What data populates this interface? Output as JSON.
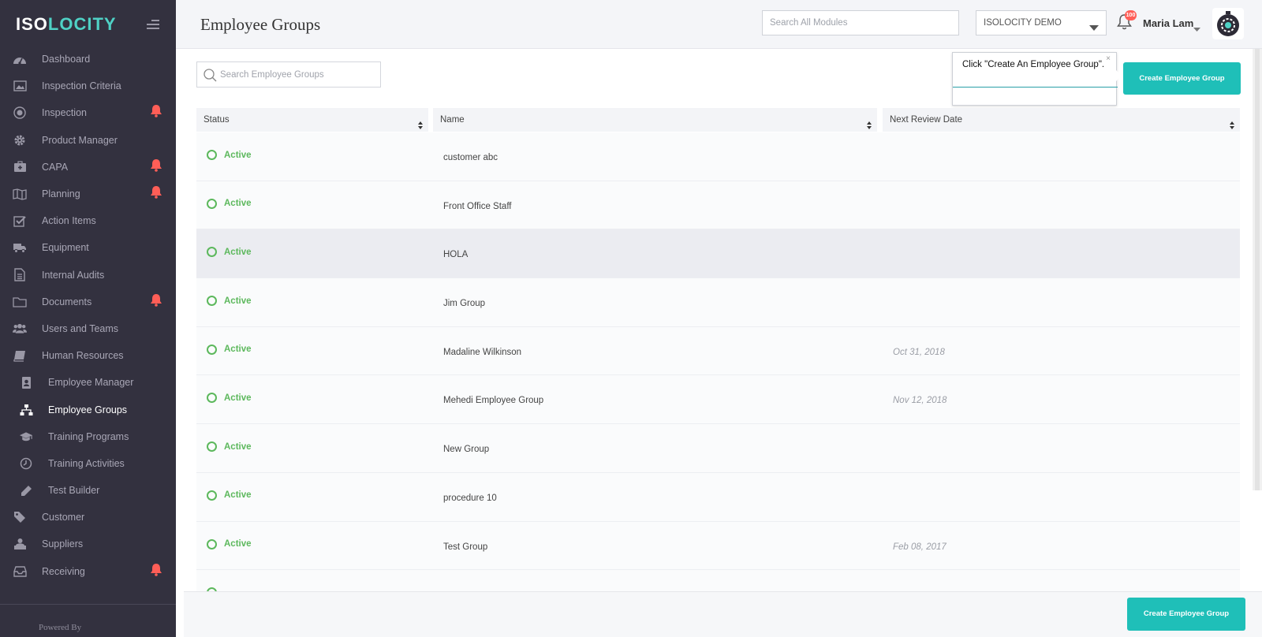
{
  "brand": {
    "part1": "ISO",
    "part2": "LOCITY"
  },
  "sidebar": {
    "items": [
      {
        "label": "Dashboard",
        "icon": "dashboard-icon"
      },
      {
        "label": "Inspection Criteria",
        "icon": "image-icon"
      },
      {
        "label": "Inspection",
        "icon": "target-icon",
        "alert": true
      },
      {
        "label": "Product Manager",
        "icon": "gear-icon"
      },
      {
        "label": "CAPA",
        "icon": "briefcase-medical-icon",
        "alert": true
      },
      {
        "label": "Planning",
        "icon": "map-icon",
        "alert": true
      },
      {
        "label": "Action Items",
        "icon": "checkbox-icon"
      },
      {
        "label": "Equipment",
        "icon": "truck-icon"
      },
      {
        "label": "Internal Audits",
        "icon": "document-icon"
      },
      {
        "label": "Documents",
        "icon": "folder-icon",
        "alert": true
      },
      {
        "label": "Users and Teams",
        "icon": "users-icon"
      },
      {
        "label": "Human Resources",
        "icon": "book-icon"
      },
      {
        "label": "Employee Manager",
        "icon": "id-badge-icon",
        "sub": true
      },
      {
        "label": "Employee Groups",
        "icon": "sitemap-icon",
        "sub": true,
        "active": true
      },
      {
        "label": "Training Programs",
        "icon": "graduation-cap-icon",
        "sub": true
      },
      {
        "label": "Training Activities",
        "icon": "clock-icon",
        "sub": true
      },
      {
        "label": "Test Builder",
        "icon": "pencil-icon",
        "sub": true
      },
      {
        "label": "Customer",
        "icon": "tag-icon"
      },
      {
        "label": "Suppliers",
        "icon": "supplier-icon"
      },
      {
        "label": "Receiving",
        "icon": "inbox-icon",
        "alert": true
      }
    ],
    "powered_by": "Powered By"
  },
  "header": {
    "title": "Employee Groups",
    "search_placeholder": "Search All Modules",
    "company": "ISOLOCITY DEMO",
    "notification_count": "100",
    "user_name": "Maria Lam"
  },
  "toolbar": {
    "search_placeholder": "Search Employee Groups",
    "create_label": "Create Employee Group"
  },
  "tooltip": {
    "text": "Click \"Create An Employee Group\".",
    "close": "×"
  },
  "table": {
    "columns": [
      "Status",
      "Name",
      "Next Review Date"
    ],
    "rows": [
      {
        "status": "Active",
        "name": "customer abc",
        "date": ""
      },
      {
        "status": "Active",
        "name": "Front Office Staff",
        "date": ""
      },
      {
        "status": "Active",
        "name": "HOLA",
        "date": ""
      },
      {
        "status": "Active",
        "name": "Jim Group",
        "date": ""
      },
      {
        "status": "Active",
        "name": "Madaline Wilkinson",
        "date": "Oct 31, 2018"
      },
      {
        "status": "Active",
        "name": "Mehedi Employee Group",
        "date": "Nov 12, 2018"
      },
      {
        "status": "Active",
        "name": "New Group",
        "date": ""
      },
      {
        "status": "Active",
        "name": "procedure 10",
        "date": ""
      },
      {
        "status": "Active",
        "name": "Test Group",
        "date": "Feb 08, 2017"
      }
    ]
  },
  "colors": {
    "sidebar": "#33313f",
    "accent": "#1fbfb8",
    "active_status": "#5cb85c",
    "alert": "#ff5e57"
  }
}
